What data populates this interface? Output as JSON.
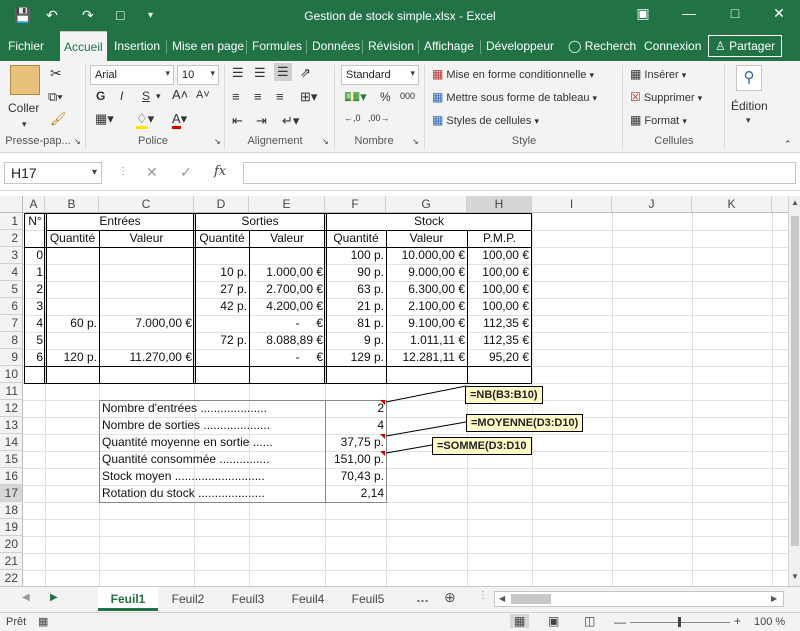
{
  "window": {
    "title": "Gestion de stock simple.xlsx - Excel"
  },
  "tabs": [
    "Fichier",
    "Accueil",
    "Insertion",
    "Mise en page",
    "Formules",
    "Données",
    "Révision",
    "Affichage",
    "Développeur"
  ],
  "tell_me": "Recherch",
  "account": {
    "sign_in": "Connexion",
    "share": "Partager"
  },
  "ribbon": {
    "clipboard": {
      "paste": "Coller",
      "label": "Presse-pap..."
    },
    "font": {
      "name": "Arial",
      "size": "10",
      "bold": "G",
      "italic": "I",
      "underline": "S",
      "label": "Police"
    },
    "alignment": {
      "label": "Alignement"
    },
    "number": {
      "format": "Standard",
      "percent": "%",
      "thousands": "000",
      "label": "Nombre"
    },
    "styles": {
      "conditional": "Mise en forme conditionnelle",
      "table": "Mettre sous forme de tableau",
      "cell_styles": "Styles de cellules",
      "label": "Style"
    },
    "cells": {
      "insert": "Insérer",
      "delete": "Supprimer",
      "format": "Format",
      "label": "Cellules"
    },
    "editing": {
      "label": "Édition"
    }
  },
  "formula_bar": {
    "name_box": "H17",
    "fx": "fx",
    "value": ""
  },
  "columns": [
    "A",
    "B",
    "C",
    "D",
    "E",
    "F",
    "G",
    "H",
    "I",
    "J",
    "K"
  ],
  "rows": [
    "1",
    "2",
    "3",
    "4",
    "5",
    "6",
    "7",
    "8",
    "9",
    "10",
    "11",
    "12",
    "13",
    "14",
    "15",
    "16",
    "17",
    "18",
    "19",
    "20",
    "21",
    "22"
  ],
  "sheet": {
    "headers": {
      "num": "N°",
      "entrees": "Entrées",
      "sorties": "Sorties",
      "stock": "Stock",
      "quantite": "Quantité",
      "valeur": "Valeur",
      "pmp": "P.M.P."
    },
    "data": [
      {
        "n": "0",
        "eq": "",
        "ev": "",
        "sq": "",
        "sv": "",
        "tq": "100 p.",
        "tv": "10.000,00 €",
        "pmp": "100,00 €"
      },
      {
        "n": "1",
        "eq": "",
        "ev": "",
        "sq": "10 p.",
        "sv": "1.000,00 €",
        "tq": "90 p.",
        "tv": "9.000,00 €",
        "pmp": "100,00 €"
      },
      {
        "n": "2",
        "eq": "",
        "ev": "",
        "sq": "27 p.",
        "sv": "2.700,00 €",
        "tq": "63 p.",
        "tv": "6.300,00 €",
        "pmp": "100,00 €"
      },
      {
        "n": "3",
        "eq": "",
        "ev": "",
        "sq": "42 p.",
        "sv": "4.200,00 €",
        "tq": "21 p.",
        "tv": "2.100,00 €",
        "pmp": "100,00 €"
      },
      {
        "n": "4",
        "eq": "60 p.",
        "ev": "7.000,00 €",
        "sq": "",
        "sv": "-     €",
        "tq": "81 p.",
        "tv": "9.100,00 €",
        "pmp": "112,35 €"
      },
      {
        "n": "5",
        "eq": "",
        "ev": "",
        "sq": "72 p.",
        "sv": "8.088,89 €",
        "tq": "9 p.",
        "tv": "1.011,11 €",
        "pmp": "112,35 €"
      },
      {
        "n": "6",
        "eq": "120 p.",
        "ev": "11.270,00 €",
        "sq": "",
        "sv": "-     €",
        "tq": "129 p.",
        "tv": "12.281,11 €",
        "pmp": "95,20 €"
      }
    ],
    "summary": [
      {
        "label": "Nombre d'entrées ....................",
        "value": "2"
      },
      {
        "label": "Nombre de sorties ....................",
        "value": "4"
      },
      {
        "label": "Quantité moyenne en sortie ......",
        "value": "37,75 p."
      },
      {
        "label": "Quantité consommée ...............",
        "value": "151,00 p."
      },
      {
        "label": "Stock moyen ...........................",
        "value": "70,43 p."
      },
      {
        "label": "Rotation du stock ....................",
        "value": "2,14"
      }
    ],
    "notes": [
      "=NB(B3:B10)",
      "=MOYENNE(D3:D10)",
      "=SOMME(D3:D10"
    ]
  },
  "sheet_tabs": [
    "Feuil1",
    "Feuil2",
    "Feuil3",
    "Feuil4",
    "Feuil5"
  ],
  "status": {
    "ready": "Prêt",
    "zoom": "100 %"
  }
}
